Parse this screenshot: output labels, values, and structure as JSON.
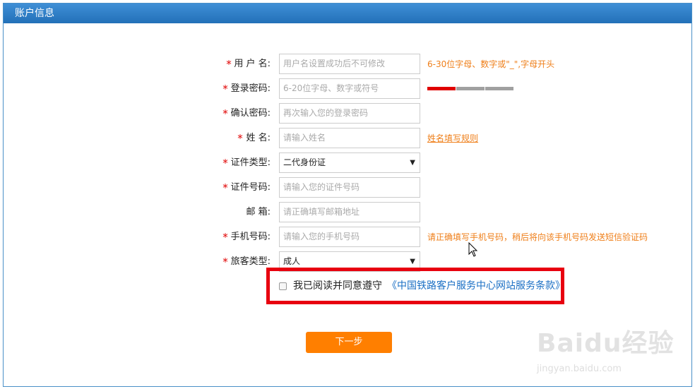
{
  "header": {
    "title": "账户信息"
  },
  "form": {
    "username": {
      "label": "用 户 名:",
      "placeholder": "用户名设置成功后不可修改",
      "hint": "6-30位字母、数字或\"_\",字母开头"
    },
    "password": {
      "label": "登录密码:",
      "placeholder": "6-20位字母、数字或符号",
      "strength_colors": [
        "#e00000",
        "#a0a0a0",
        "#a0a0a0"
      ]
    },
    "confirm_password": {
      "label": "确认密码:",
      "placeholder": "再次输入您的登录密码"
    },
    "name": {
      "label": "姓 名:",
      "placeholder": "请输入姓名",
      "hint_link": "姓名填写规则"
    },
    "id_type": {
      "label": "证件类型:",
      "value": "二代身份证"
    },
    "id_number": {
      "label": "证件号码:",
      "placeholder": "请输入您的证件号码"
    },
    "email": {
      "label": "邮 箱:",
      "placeholder": "请正确填写邮箱地址"
    },
    "phone": {
      "label": "手机号码:",
      "placeholder": "请输入您的手机号码",
      "hint": "请正确填写手机号码，稍后将向该手机号码发送短信验证码"
    },
    "passenger_type": {
      "label": "旅客类型:",
      "value": "成人"
    },
    "required_mark": "*"
  },
  "agreement": {
    "text": "我已阅读并同意遵守",
    "link": "《中国铁路客户服务中心网站服务条款》"
  },
  "next_button": {
    "label": "下一步"
  },
  "watermark": {
    "main": "Baidu经验",
    "sub": "jingyan.baidu.com"
  },
  "colors": {
    "accent": "#2370b8",
    "hint": "#ef7f1a",
    "required": "#e00000",
    "highlight_border": "#e8000f",
    "button": "#ff7f00",
    "link": "#1a6fc4"
  }
}
